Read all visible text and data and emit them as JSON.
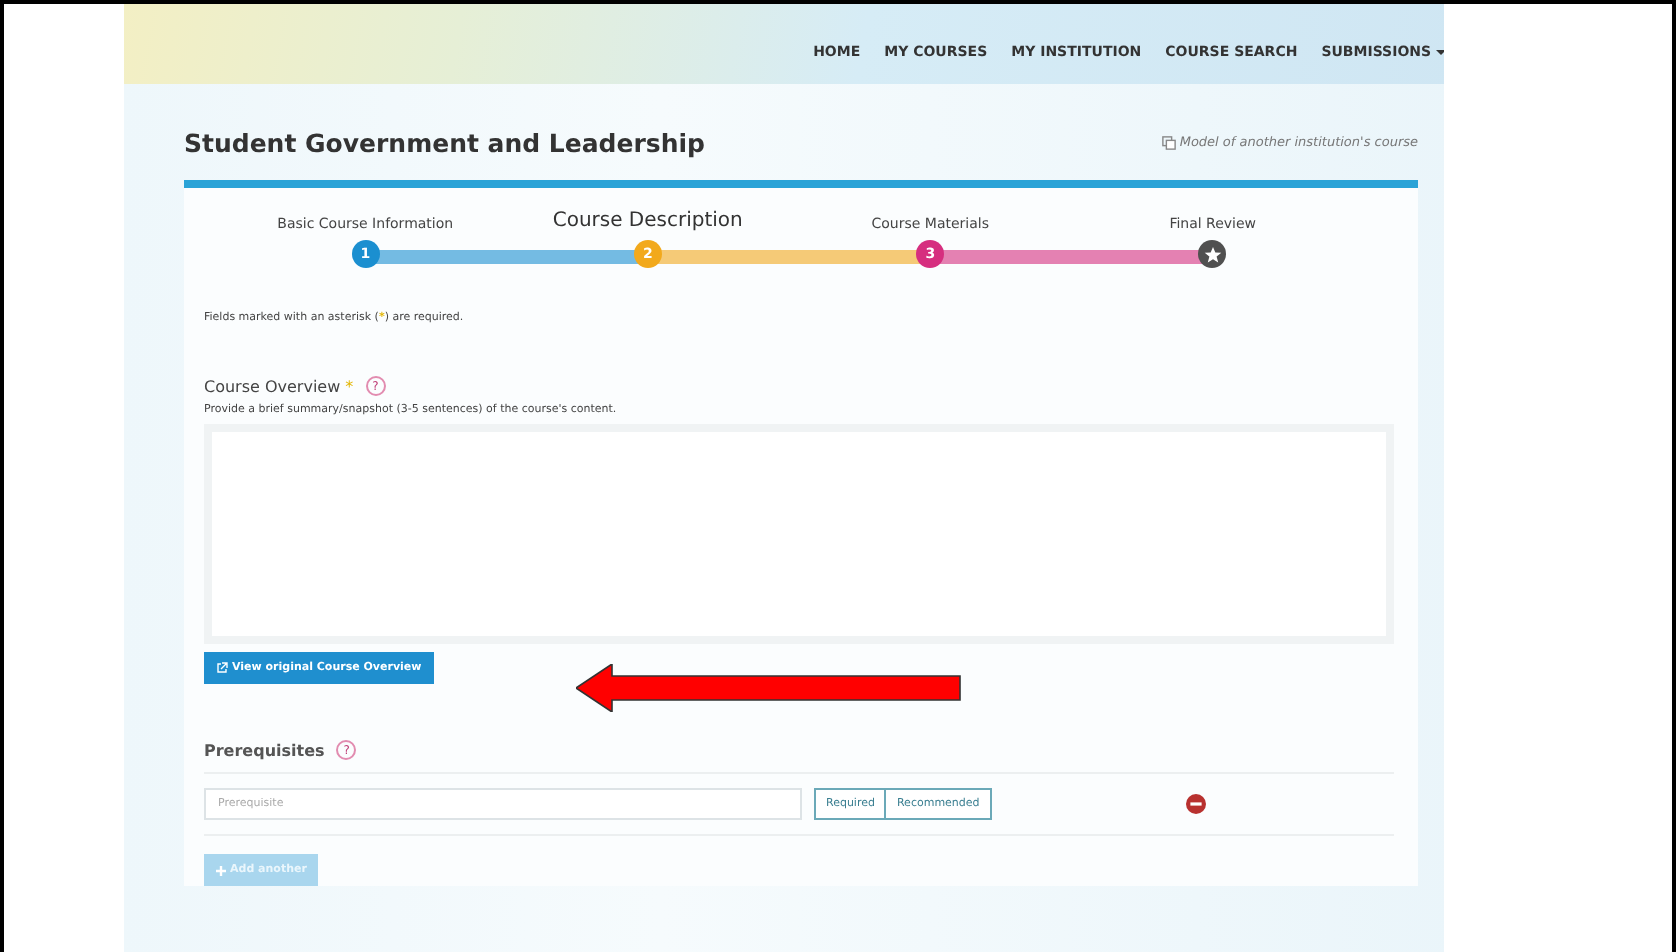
{
  "nav": {
    "items": [
      {
        "label": "HOME",
        "dropdown": false
      },
      {
        "label": "MY COURSES",
        "dropdown": false
      },
      {
        "label": "MY INSTITUTION",
        "dropdown": false
      },
      {
        "label": "COURSE SEARCH",
        "dropdown": false
      },
      {
        "label": "SUBMISSIONS",
        "dropdown": true
      }
    ]
  },
  "page_title": "Student Government and Leadership",
  "model_note": "Model of another institution's course",
  "steps": [
    {
      "label": "Basic Course Information",
      "kind": "number",
      "marker": "1",
      "color": "#1b8fd0",
      "selected": false
    },
    {
      "label": "Course Description",
      "kind": "number",
      "marker": "2",
      "color": "#f2a91c",
      "selected": true
    },
    {
      "label": "Course Materials",
      "kind": "number",
      "marker": "3",
      "color": "#d62e7f",
      "selected": false
    },
    {
      "label": "Final Review",
      "kind": "star",
      "color": "#505050",
      "selected": false
    }
  ],
  "required_note": {
    "before": "Fields marked with an asterisk (",
    "mark": "*",
    "after": ") are required."
  },
  "course_overview": {
    "label": "Course Overview",
    "required": true,
    "help": "?",
    "hint": "Provide a brief summary/snapshot (3-5 sentences) of the course's content.",
    "button": "View original Course Overview"
  },
  "prerequisites": {
    "label": "Prerequisites",
    "help": "?",
    "rows": [
      {
        "placeholder": "Prerequisite",
        "options": [
          {
            "label": "Required",
            "selected": false
          },
          {
            "label": "Recommended",
            "selected": false
          }
        ]
      }
    ],
    "add_button": {
      "label": "Add another",
      "disabled": true
    }
  }
}
